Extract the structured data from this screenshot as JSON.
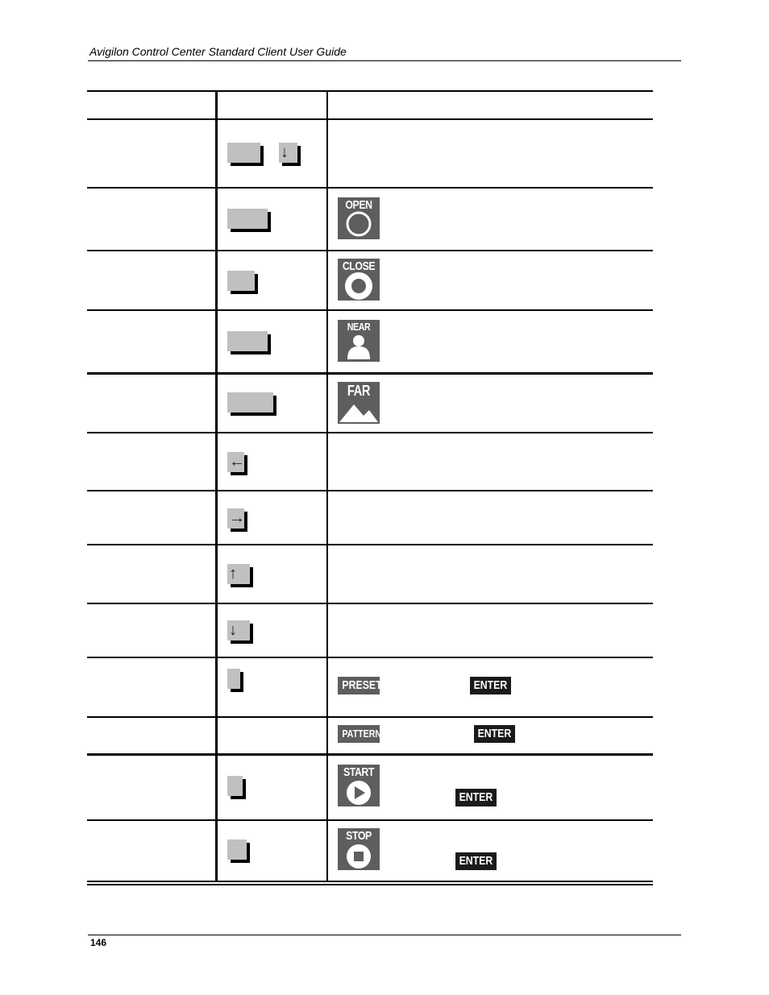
{
  "header": {
    "title": "Avigilon Control Center Standard Client User Guide"
  },
  "footer": {
    "page_number": "146"
  },
  "table": {
    "rows": [
      {
        "keys": [
          "",
          "↓"
        ],
        "icon": null
      },
      {
        "keys": [
          ""
        ],
        "icon": "OPEN"
      },
      {
        "keys": [
          ""
        ],
        "icon": "CLOSE"
      },
      {
        "keys": [
          ""
        ],
        "icon": "NEAR"
      },
      {
        "keys": [
          ""
        ],
        "icon": "FAR"
      },
      {
        "keys": [
          "←"
        ],
        "icon": null
      },
      {
        "keys": [
          "→"
        ],
        "icon": null
      },
      {
        "keys": [
          "↑"
        ],
        "icon": null
      },
      {
        "keys": [
          "↓"
        ],
        "icon": null
      },
      {
        "keys": [
          ""
        ],
        "tags": [
          "PRESET",
          "ENTER"
        ]
      },
      {
        "keys": [],
        "tags": [
          "PATTERN",
          "ENTER"
        ]
      },
      {
        "keys": [
          ""
        ],
        "icon": "START",
        "tags": [
          "ENTER"
        ]
      },
      {
        "keys": [
          ""
        ],
        "icon": "STOP",
        "tags": [
          "ENTER"
        ]
      }
    ]
  },
  "icons": {
    "open": {
      "label": "OPEN",
      "name": "iris-open-icon"
    },
    "close": {
      "label": "CLOSE",
      "name": "iris-close-icon"
    },
    "near": {
      "label": "NEAR",
      "name": "focus-near-icon"
    },
    "far": {
      "label": "FAR",
      "name": "focus-far-icon"
    },
    "start": {
      "label": "START",
      "name": "start-icon"
    },
    "stop": {
      "label": "STOP",
      "name": "stop-icon"
    }
  },
  "tags": {
    "preset": "PRESET",
    "pattern": "PATTERN",
    "enter": "ENTER"
  },
  "arrows": {
    "left": "←",
    "right": "→",
    "up": "↑",
    "down": "↓"
  },
  "colors": {
    "icon_bg": "#5e5e5e",
    "key_bg": "#c0c0c0",
    "enter_bg": "#1a1a1a"
  }
}
